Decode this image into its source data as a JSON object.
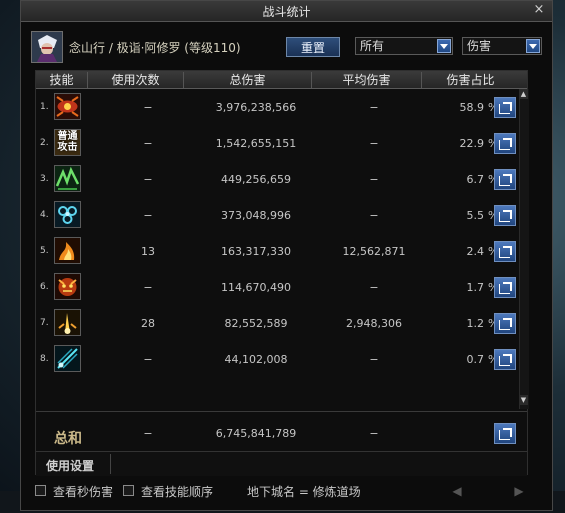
{
  "window": {
    "title": "战斗统计",
    "close_label": "×"
  },
  "character": {
    "name": "念山行 / 极诣·阿修罗 (等级110)"
  },
  "controls": {
    "reset_label": "重置",
    "filter_selected": "所有",
    "metric_selected": "伤害"
  },
  "table": {
    "headers": [
      "技能",
      "使用次数",
      "总伤害",
      "平均伤害",
      "伤害占比"
    ],
    "rows": [
      {
        "num": "1.",
        "icon": "eye-skill-icon",
        "uses": "−",
        "total": "3,976,238,566",
        "avg": "−",
        "pct": "58.9",
        "pct_symbol": "%"
      },
      {
        "num": "2.",
        "icon": "normal-attack-icon",
        "icon_text": "普通攻击",
        "uses": "−",
        "total": "1,542,655,151",
        "avg": "−",
        "pct": "22.9",
        "pct_symbol": "%"
      },
      {
        "num": "3.",
        "icon": "green-wave-skill-icon",
        "uses": "−",
        "total": "449,256,659",
        "avg": "−",
        "pct": "6.7",
        "pct_symbol": "%"
      },
      {
        "num": "4.",
        "icon": "blue-orb-skill-icon",
        "uses": "−",
        "total": "373,048,996",
        "avg": "−",
        "pct": "5.5",
        "pct_symbol": "%"
      },
      {
        "num": "5.",
        "icon": "flame-slash-skill-icon",
        "uses": "13",
        "total": "163,317,330",
        "avg": "12,562,871",
        "pct": "2.4",
        "pct_symbol": "%"
      },
      {
        "num": "6.",
        "icon": "demon-face-skill-icon",
        "uses": "−",
        "total": "114,670,490",
        "avg": "−",
        "pct": "1.7",
        "pct_symbol": "%"
      },
      {
        "num": "7.",
        "icon": "fire-pillar-skill-icon",
        "uses": "28",
        "total": "82,552,589",
        "avg": "2,948,306",
        "pct": "1.2",
        "pct_symbol": "%"
      },
      {
        "num": "8.",
        "icon": "cyan-wave-skill-icon",
        "uses": "−",
        "total": "44,102,008",
        "avg": "−",
        "pct": "0.7",
        "pct_symbol": "%"
      }
    ],
    "total": {
      "label": "总和",
      "uses": "−",
      "total": "6,745,841,789",
      "avg": "−"
    }
  },
  "settings": {
    "label": "使用设置"
  },
  "footer": {
    "check_dps_label": "查看秒伤害",
    "check_order_label": "查看技能顺序",
    "dungeon_text": "地下城名 = 修炼道场",
    "prev_label": "◀",
    "next_label": "▶"
  },
  "colors": {
    "accent_blue": "#2e4e7a",
    "gold_text": "#cbb98a"
  }
}
